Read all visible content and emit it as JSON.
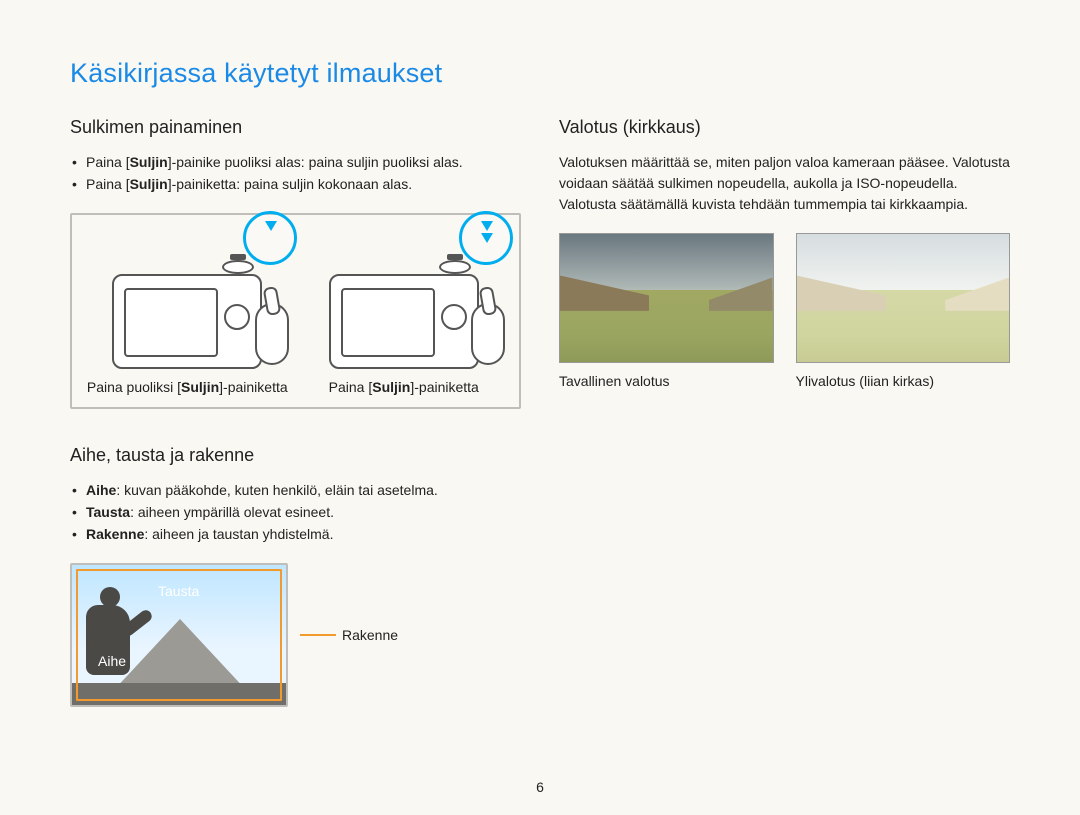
{
  "title": "Käsikirjassa käytetyt ilmaukset",
  "page_number": "6",
  "left": {
    "shutter": {
      "heading": "Sulkimen painaminen",
      "items": [
        {
          "pre": "Paina [",
          "bold": "Suljin",
          "post": "]-painike puoliksi alas: paina suljin puoliksi alas."
        },
        {
          "pre": "Paina [",
          "bold": "Suljin",
          "post": "]-painiketta: paina suljin kokonaan alas."
        }
      ],
      "caption_half_pre": "Paina puoliksi [",
      "caption_half_bold": "Suljin",
      "caption_half_post": "]-painiketta",
      "caption_full_pre": "Paina [",
      "caption_full_bold": "Suljin",
      "caption_full_post": "]-painiketta"
    },
    "composition": {
      "heading": "Aihe, tausta ja rakenne",
      "items": [
        {
          "bold": "Aihe",
          "post": ": kuvan pääkohde, kuten henkilö, eläin tai asetelma."
        },
        {
          "bold": "Tausta",
          "post": ": aiheen ympärillä olevat esineet."
        },
        {
          "bold": "Rakenne",
          "post": ": aiheen ja taustan yhdistelmä."
        }
      ],
      "label_tausta": "Tausta",
      "label_aihe": "Aihe",
      "label_rakenne": "Rakenne"
    }
  },
  "right": {
    "exposure": {
      "heading": "Valotus (kirkkaus)",
      "body": "Valotuksen määrittää se, miten paljon valoa kameraan pääsee. Valotusta voidaan säätää sulkimen nopeudella, aukolla ja ISO-nopeudella. Valotusta säätämällä kuvista tehdään tummempia tai kirkkaampia.",
      "caption_normal": "Tavallinen valotus",
      "caption_over": "Ylivalotus (liian kirkas)"
    }
  }
}
